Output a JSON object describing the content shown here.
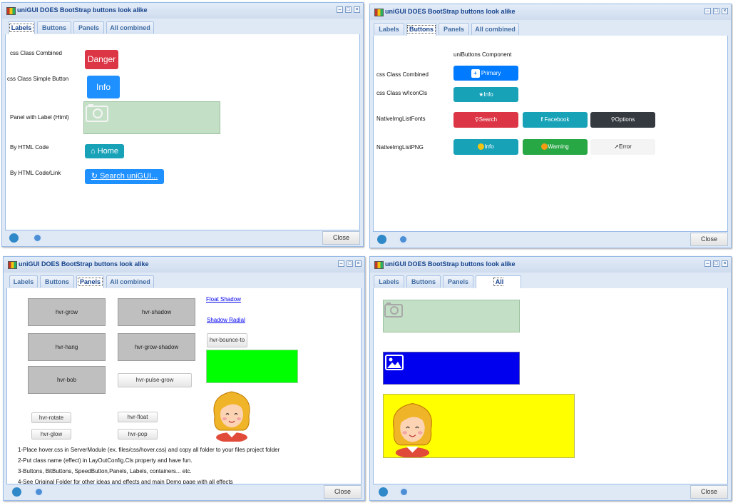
{
  "common": {
    "window_title": "uniGUI DOES BootStrap buttons look alike",
    "tabs": [
      "Labels",
      "Buttons",
      "Panels",
      "All combined"
    ],
    "close_label": "Close",
    "minimize_glyph": "–",
    "maximize_glyph": "□",
    "close_glyph": "×"
  },
  "win1": {
    "rows": [
      {
        "label": "css Class Combined",
        "button": "Danger"
      },
      {
        "label": "css Class Simple Button",
        "button": "Info"
      },
      {
        "label": "Panel with Label (Html)"
      },
      {
        "label": "By HTML Code",
        "button": "Home",
        "icon": "home-icon"
      },
      {
        "label": "By HTML Code/Link",
        "button": "Search uniGUI...",
        "icon": "refresh-icon"
      }
    ]
  },
  "win2": {
    "component_label": "uniButtons Component",
    "row_labels": [
      "css Class Combined",
      "css Class w/IconCls",
      "NativeImgListFonts",
      "NativeImgListPNG"
    ],
    "primary": "Primary",
    "info_icon_cls": "Info",
    "fonts_buttons": [
      "Search",
      "Facebook",
      "Options"
    ],
    "png_buttons": [
      "Info",
      "Warning",
      "Error"
    ]
  },
  "win3": {
    "boxes": [
      "hvr-grow",
      "hvr-shadow",
      "hvr-hang",
      "hvr-grow-shadow",
      "hvr-bob"
    ],
    "pulse_grow": "hvr-pulse-grow",
    "links": [
      "Float Shadow",
      "Shadow Radial"
    ],
    "bounce": "hvr-bounce-to",
    "small_buttons": [
      "hvr-rotate",
      "hvr-float",
      "hvr-glow",
      "hvr-pop"
    ],
    "notes": [
      "1-Place hover.css in ServerModule (ex. files/css/hover.css) and copy all folder to your files project folder",
      "2-Put class name (effect) in LayOutConfig.Cls property and have fun.",
      "3-Buttons, BitButtons, SpeedButton,Panels, Labels, containers... etc.",
      "4-See Original Folder for other ideas and effects and main Demo page with all effects"
    ]
  },
  "colors": {
    "danger": "#dc3545",
    "info_blue": "#1e90ff",
    "teal": "#17a2b8",
    "primary": "#007bff",
    "success": "#28a745",
    "dark": "#343a40",
    "panel_green": "#c3dfc5",
    "bright_green": "#00ff00",
    "blue_panel": "#0000ee",
    "yellow_panel": "#ffff00"
  },
  "icons": [
    "app-icon",
    "telegram-icon",
    "globe-icon",
    "camera-icon",
    "image-icon",
    "girl-avatar-icon"
  ]
}
